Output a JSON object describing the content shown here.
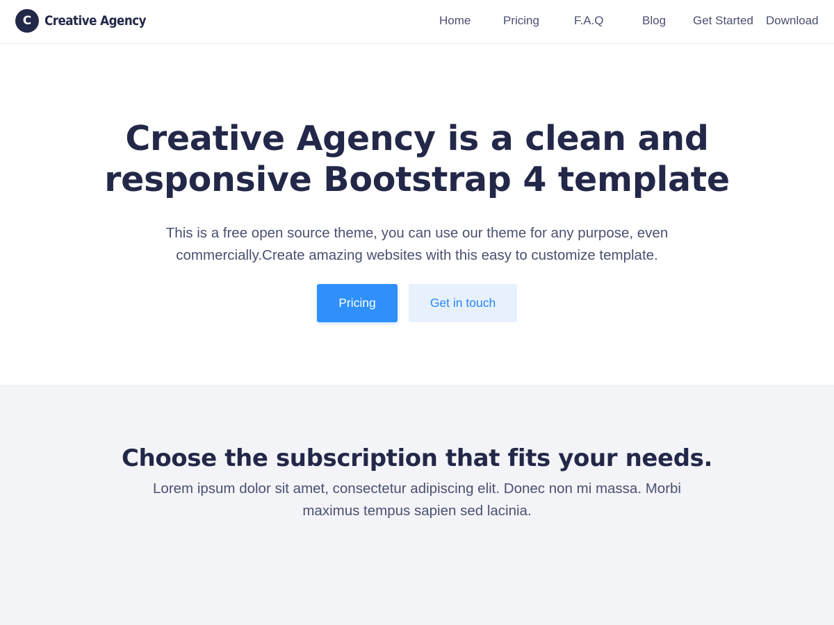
{
  "brand": {
    "logo_letter": "C",
    "name": "Creative Agency"
  },
  "nav": {
    "items": [
      {
        "label": "Home"
      },
      {
        "label": "Pricing"
      },
      {
        "label": "F.A.Q"
      },
      {
        "label": "Blog"
      },
      {
        "label": "Get Started"
      },
      {
        "label": "Download"
      }
    ]
  },
  "hero": {
    "title": "Creative Agency is a clean and responsive Bootstrap 4 template",
    "subtitle": "This is a free open source theme, you can use our theme for any purpose, even commercially.Create amazing websites with this easy to customize template.",
    "primary_button": "Pricing",
    "secondary_button": "Get in touch"
  },
  "pricing": {
    "title": "Choose the subscription that fits your needs.",
    "text": "Lorem ipsum dolor sit amet, consectetur adipiscing elit. Donec non mi massa. Morbi maximus tempus sapien sed lacinia."
  },
  "colors": {
    "navy": "#232849",
    "body_text": "#4a5070",
    "primary_blue": "#2f8ffb",
    "light_blue_bg": "#e7f1fe",
    "section_gray": "#f3f4f7"
  }
}
